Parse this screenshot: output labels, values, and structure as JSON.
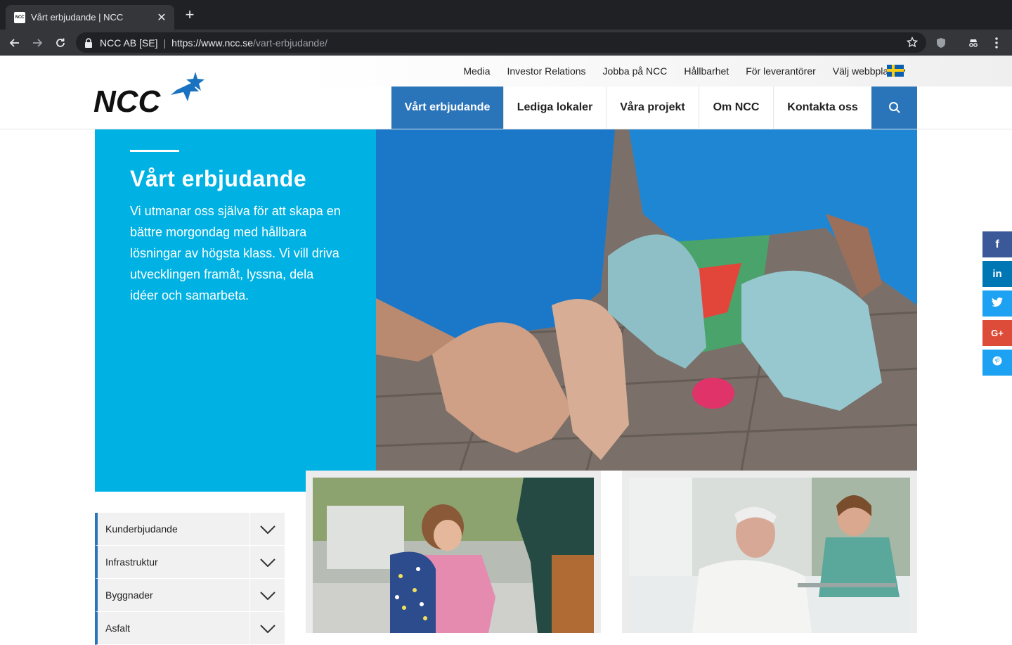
{
  "browser": {
    "tab_title": "Vårt erbjudande | NCC",
    "favicon_text": "NCC",
    "site_identity": "NCC AB [SE]",
    "url_host": "https://www.ncc.se",
    "url_path": "/vart-erbjudande/"
  },
  "topbar": {
    "links": [
      "Media",
      "Investor Relations",
      "Jobba på NCC",
      "Hållbarhet",
      "För leverantörer"
    ],
    "language_label": "Välj webbplats"
  },
  "logo": {
    "text": "NCC",
    "colors": {
      "text": "#111111",
      "star": "#1a73c0"
    }
  },
  "nav": {
    "items": [
      {
        "label": "Vårt erbjudande",
        "active": true
      },
      {
        "label": "Lediga lokaler",
        "active": false
      },
      {
        "label": "Våra projekt",
        "active": false
      },
      {
        "label": "Om NCC",
        "active": false
      },
      {
        "label": "Kontakta oss",
        "active": false
      }
    ],
    "search_icon": "search-icon"
  },
  "hero": {
    "title": "Vårt erbjudande",
    "text": "Vi utmanar oss själva för att skapa en bättre morgondag med hållbara lösningar av högsta klass. Vi vill driva utvecklingen framåt, lyssna, dela idéer och samarbeta.",
    "image": "painted-hands-photo"
  },
  "cards": [
    {
      "image": "child-with-backpack-photo"
    },
    {
      "image": "hospital-patient-nurse-photo"
    }
  ],
  "accordion": {
    "items": [
      "Kunderbjudande",
      "Infrastruktur",
      "Byggnader",
      "Asfalt"
    ]
  },
  "social": [
    {
      "icon": "facebook-icon",
      "glyph": "f",
      "color": "#3b5998"
    },
    {
      "icon": "linkedin-icon",
      "glyph": "in",
      "color": "#0077b5"
    },
    {
      "icon": "twitter-icon",
      "glyph": "t",
      "color": "#1da1f2"
    },
    {
      "icon": "google-plus-icon",
      "glyph": "G+",
      "color": "#dd4b39"
    },
    {
      "icon": "pinterest-icon",
      "glyph": "p",
      "color": "#1da1f2"
    }
  ],
  "colors": {
    "brand_blue": "#2a74b9",
    "hero_cyan": "#00b1e3"
  }
}
